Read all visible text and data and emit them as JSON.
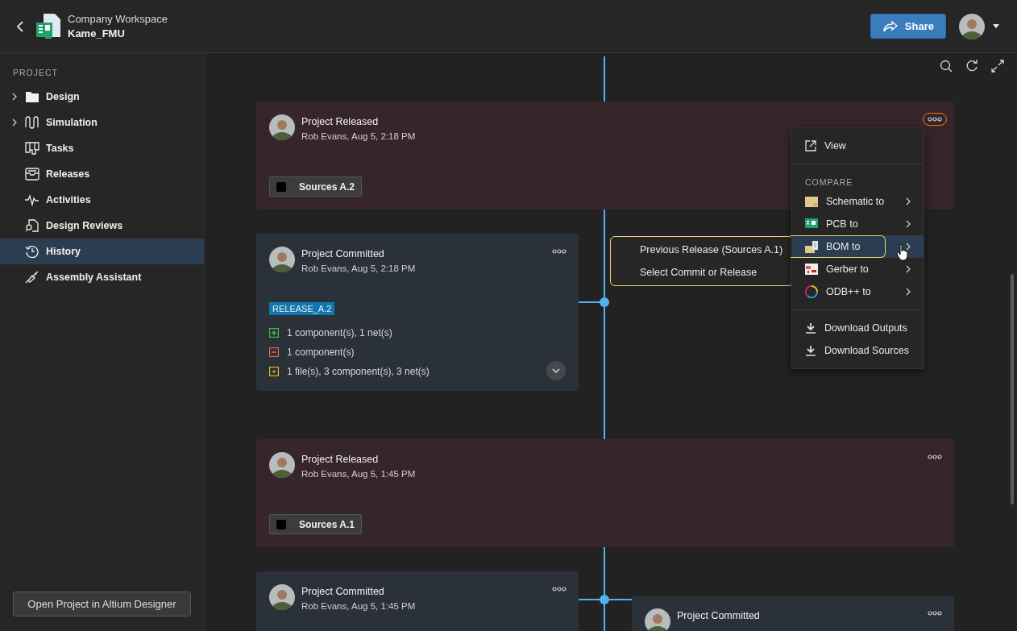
{
  "header": {
    "workspace": "Company Workspace",
    "project": "Kame_FMU",
    "share_button": "Share"
  },
  "sidebar": {
    "heading": "PROJECT",
    "items": [
      {
        "label": "Design",
        "expandable": true,
        "selected": false
      },
      {
        "label": "Simulation",
        "expandable": true,
        "selected": false
      },
      {
        "label": "Tasks",
        "expandable": false,
        "selected": false
      },
      {
        "label": "Releases",
        "expandable": false,
        "selected": false
      },
      {
        "label": "Activities",
        "expandable": false,
        "selected": false
      },
      {
        "label": "Design Reviews",
        "expandable": false,
        "selected": false
      },
      {
        "label": "History",
        "expandable": false,
        "selected": true
      },
      {
        "label": "Assembly Assistant",
        "expandable": false,
        "selected": false
      }
    ],
    "footer_button": "Open Project in Altium Designer"
  },
  "timeline": [
    {
      "items": [
        {
          "kind": "release",
          "title": "Project Released",
          "meta": "Rob Evans, Aug 5, 2:18 PM",
          "tag": "Sources A.2",
          "menu_open": true
        }
      ]
    },
    {
      "items": [
        {
          "kind": "commit",
          "title": "Project Committed",
          "meta": "Rob Evans, Aug 5, 2:18 PM",
          "label": "RELEASE_A.2",
          "changes": [
            {
              "kind": "added",
              "text": "1 component(s), 1 net(s)"
            },
            {
              "kind": "removed",
              "text": "1 component(s)"
            },
            {
              "kind": "modified",
              "text": "1 file(s), 3 component(s), 3 net(s)"
            }
          ],
          "menu_open": false
        }
      ]
    },
    {
      "items": [
        {
          "kind": "release",
          "title": "Project Released",
          "meta": "Rob Evans, Aug 5, 1:45 PM",
          "tag": "Sources A.1",
          "menu_open": false
        }
      ]
    },
    {
      "items": [
        {
          "kind": "commit",
          "title": "Project Committed",
          "meta": "Rob Evans, Aug 5, 1:45 PM",
          "menu_open": false
        },
        {
          "kind": "commit",
          "title": "Project Committed",
          "menu_open": false
        }
      ]
    }
  ],
  "menu": {
    "sections": [
      {
        "items": [
          {
            "label": "View",
            "submenu": false,
            "selected": false
          }
        ]
      },
      {
        "heading": "COMPARE",
        "items": [
          {
            "label": "Schematic to",
            "submenu": true,
            "selected": false
          },
          {
            "label": "PCB to",
            "submenu": true,
            "selected": false
          },
          {
            "label": "BOM to",
            "submenu": true,
            "selected": true
          },
          {
            "label": "Gerber to",
            "submenu": true,
            "selected": false
          },
          {
            "label": "ODB++ to",
            "submenu": true,
            "selected": false
          }
        ]
      },
      {
        "items": [
          {
            "label": "Download Outputs",
            "submenu": false,
            "selected": false
          },
          {
            "label": "Download Sources",
            "submenu": false,
            "selected": false
          }
        ]
      }
    ]
  },
  "submenu": {
    "items": [
      "Previous Release (Sources A.1)",
      "Select Commit or Release"
    ]
  }
}
